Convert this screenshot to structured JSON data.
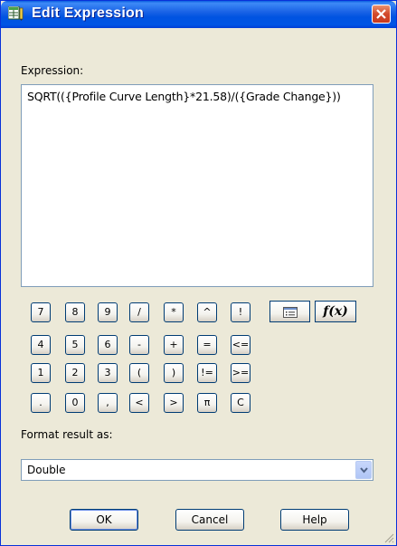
{
  "window": {
    "title": "Edit Expression",
    "icon": "table-edit-icon",
    "close_icon": "close-icon"
  },
  "expression": {
    "label": "Expression:",
    "value": "SQRT(({Profile Curve Length}*21.58)/({Grade Change}))"
  },
  "calculator": {
    "rows": [
      [
        "7",
        "8",
        "9",
        "/",
        "*",
        "^",
        "!"
      ],
      [
        "4",
        "5",
        "6",
        "-",
        "+",
        "=",
        "<="
      ],
      [
        "1",
        "2",
        "3",
        "(",
        ")",
        "!=",
        ">="
      ],
      [
        ".",
        "0",
        ",",
        "<",
        ">",
        "π",
        "C"
      ]
    ],
    "tools": [
      {
        "name": "fields-list-button",
        "icon": "list-icon"
      },
      {
        "name": "function-button",
        "label": "f(x)"
      }
    ]
  },
  "format": {
    "label": "Format result as:",
    "selected": "Double"
  },
  "buttons": {
    "ok": "OK",
    "cancel": "Cancel",
    "help": "Help"
  },
  "colors": {
    "titlebar": "#0055e5",
    "dialog_bg": "#ece9d8",
    "button_border": "#003c74",
    "close_button": "#d2492b"
  }
}
